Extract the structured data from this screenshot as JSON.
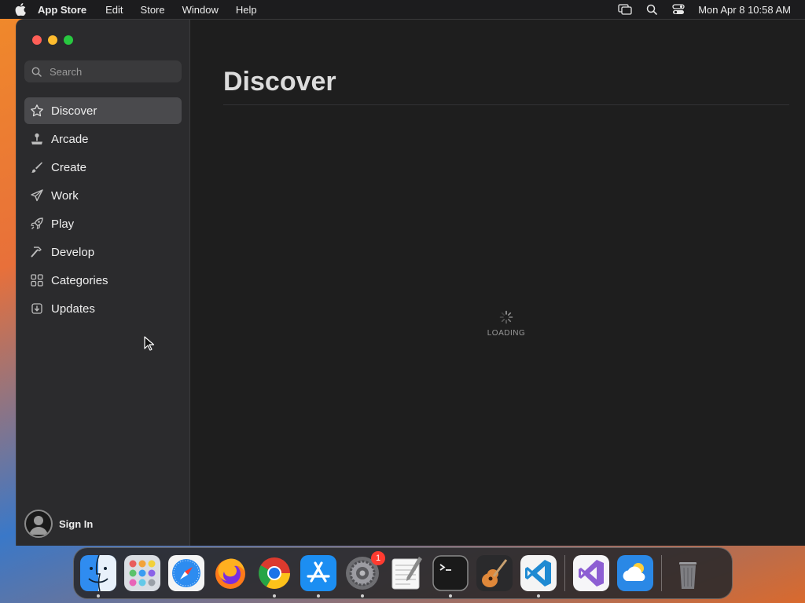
{
  "menubar": {
    "app_name": "App Store",
    "menus": [
      "Edit",
      "Store",
      "Window",
      "Help"
    ],
    "clock": "Mon Apr 8  10:58 AM"
  },
  "sidebar": {
    "search_placeholder": "Search",
    "items": [
      {
        "label": "Discover",
        "icon": "star-icon",
        "active": true
      },
      {
        "label": "Arcade",
        "icon": "joystick-icon",
        "active": false
      },
      {
        "label": "Create",
        "icon": "brush-icon",
        "active": false
      },
      {
        "label": "Work",
        "icon": "paper-plane-icon",
        "active": false
      },
      {
        "label": "Play",
        "icon": "rocket-icon",
        "active": false
      },
      {
        "label": "Develop",
        "icon": "hammer-icon",
        "active": false
      },
      {
        "label": "Categories",
        "icon": "grid-icon",
        "active": false
      },
      {
        "label": "Updates",
        "icon": "download-icon",
        "active": false
      }
    ],
    "sign_in_label": "Sign In"
  },
  "main": {
    "title": "Discover",
    "loading_label": "LOADING"
  },
  "dock": {
    "items": [
      {
        "name": "finder-icon",
        "running": true
      },
      {
        "name": "launchpad-icon",
        "running": false
      },
      {
        "name": "safari-icon",
        "running": false
      },
      {
        "name": "firefox-icon",
        "running": false
      },
      {
        "name": "chrome-icon",
        "running": true
      },
      {
        "name": "app-store-icon",
        "running": true
      },
      {
        "name": "system-settings-icon",
        "running": true,
        "badge": "1"
      },
      {
        "name": "textedit-icon",
        "running": false
      },
      {
        "name": "terminal-icon",
        "running": true
      },
      {
        "name": "garageband-icon",
        "running": false
      },
      {
        "name": "vscode-icon",
        "running": true
      },
      {
        "name": "visual-studio-icon",
        "running": false
      },
      {
        "name": "weather-icon",
        "running": false
      },
      {
        "name": "trash-icon",
        "running": false
      }
    ]
  }
}
